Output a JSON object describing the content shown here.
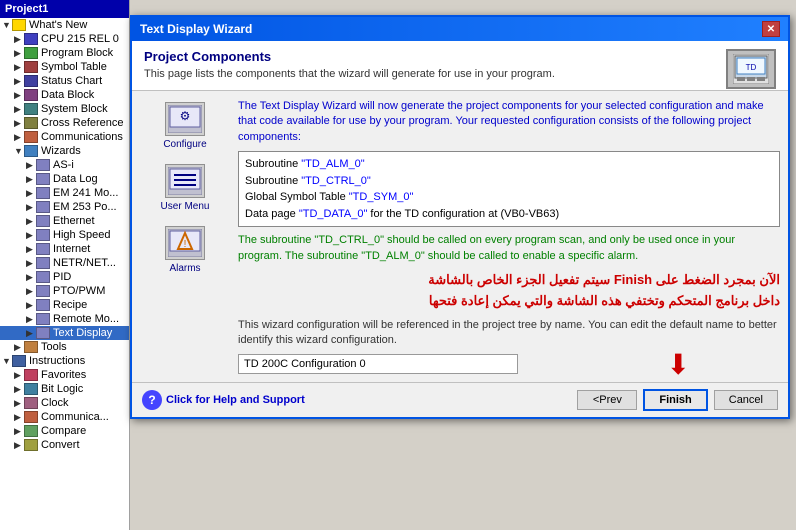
{
  "sidebar": {
    "title": "Project1",
    "items": [
      {
        "id": "whats-new",
        "label": "What's New",
        "icon": "folder",
        "indent": 0,
        "expand": true
      },
      {
        "id": "cpu",
        "label": "CPU 215 REL 0",
        "icon": "cpu",
        "indent": 1,
        "expand": false
      },
      {
        "id": "program-block",
        "label": "Program Block",
        "icon": "program",
        "indent": 1,
        "expand": false
      },
      {
        "id": "symbol-table",
        "label": "Symbol Table",
        "icon": "symbol",
        "indent": 1,
        "expand": false
      },
      {
        "id": "status-chart",
        "label": "Status Chart",
        "icon": "status",
        "indent": 1,
        "expand": false
      },
      {
        "id": "data-block",
        "label": "Data Block",
        "icon": "data",
        "indent": 1,
        "expand": false
      },
      {
        "id": "system-block",
        "label": "System Block",
        "icon": "system",
        "indent": 1,
        "expand": false
      },
      {
        "id": "cross-reference",
        "label": "Cross Reference",
        "icon": "cross",
        "indent": 1,
        "expand": false
      },
      {
        "id": "communications",
        "label": "Communications",
        "icon": "comm",
        "indent": 1,
        "expand": false
      },
      {
        "id": "wizards",
        "label": "Wizards",
        "icon": "wizard",
        "indent": 1,
        "expand": true
      },
      {
        "id": "as-i",
        "label": "AS-i",
        "icon": "generic",
        "indent": 2,
        "expand": false
      },
      {
        "id": "data-log",
        "label": "Data Log",
        "icon": "generic",
        "indent": 2,
        "expand": false
      },
      {
        "id": "em241",
        "label": "EM 241 Mo...",
        "icon": "generic",
        "indent": 2,
        "expand": false
      },
      {
        "id": "em253",
        "label": "EM 253 Po...",
        "icon": "generic",
        "indent": 2,
        "expand": false
      },
      {
        "id": "ethernet",
        "label": "Ethernet",
        "icon": "generic",
        "indent": 2,
        "expand": false
      },
      {
        "id": "high-speed",
        "label": "High Speed",
        "icon": "generic",
        "indent": 2,
        "expand": false
      },
      {
        "id": "internet",
        "label": "Internet",
        "icon": "generic",
        "indent": 2,
        "expand": false
      },
      {
        "id": "netr",
        "label": "NETR/NET...",
        "icon": "generic",
        "indent": 2,
        "expand": false
      },
      {
        "id": "pid",
        "label": "PID",
        "icon": "generic",
        "indent": 2,
        "expand": false
      },
      {
        "id": "pto-pwm",
        "label": "PTO/PWM",
        "icon": "generic",
        "indent": 2,
        "expand": false
      },
      {
        "id": "recipe",
        "label": "Recipe",
        "icon": "generic",
        "indent": 2,
        "expand": false
      },
      {
        "id": "remote-mod",
        "label": "Remote Mo...",
        "icon": "generic",
        "indent": 2,
        "expand": false
      },
      {
        "id": "text-display",
        "label": "Text Display",
        "icon": "generic",
        "indent": 2,
        "expand": false,
        "selected": true
      },
      {
        "id": "tools",
        "label": "Tools",
        "icon": "tools",
        "indent": 1,
        "expand": false
      },
      {
        "id": "instructions",
        "label": "Instructions",
        "icon": "instructions",
        "indent": 0,
        "expand": true
      },
      {
        "id": "favorites",
        "label": "Favorites",
        "icon": "favorites",
        "indent": 1,
        "expand": false
      },
      {
        "id": "bit-logic",
        "label": "Bit Logic",
        "icon": "bit",
        "indent": 1,
        "expand": false
      },
      {
        "id": "clock",
        "label": "Clock",
        "icon": "clock",
        "indent": 1,
        "expand": false
      },
      {
        "id": "communications2",
        "label": "Communica...",
        "icon": "comm",
        "indent": 1,
        "expand": false
      },
      {
        "id": "compare",
        "label": "Compare",
        "icon": "compare",
        "indent": 1,
        "expand": false
      },
      {
        "id": "convert",
        "label": "Convert",
        "icon": "convert",
        "indent": 1,
        "expand": false
      }
    ]
  },
  "dialog": {
    "title": "Text Display Wizard",
    "header": {
      "title": "Project Components",
      "description": "This page lists the components that the wizard will generate for use in your program."
    },
    "wizard_buttons": [
      {
        "id": "configure",
        "label": "Configure",
        "icon": "⚙"
      },
      {
        "id": "user-menu",
        "label": "User Menu",
        "icon": "☰"
      },
      {
        "id": "alarms",
        "label": "Alarms",
        "icon": "⚡"
      }
    ],
    "info_text_1": "The Text Display Wizard will now generate the project components for your selected configuration and make that code available for use by your program. Your requested configuration consists of the following project components:",
    "code_lines": [
      "Subroutine \"TD_ALM_0\"",
      "Subroutine \"TD_CTRL_0\"",
      "Global Symbol Table \"TD_SYM_0\"",
      "Data page \"TD_DATA_0\" for the TD configuration at (VB0-VB63)"
    ],
    "info_text_2": "The subroutine \"TD_CTRL_0\" should be called on every program scan, and only be used once in your program. The subroutine \"TD_ALM_0\" should be called to enable a specific alarm.",
    "arabic_line1": "الآن بمجرد الضغط على Finish سيتم تفعيل الجزء الخاص بالشاشة",
    "arabic_line2": "داخل برنامج المتحكم وتختفي هذه الشاشة والتي يمكن إعادة فتحها",
    "info_text_3": "This wizard configuration will be referenced in the project tree by name. You can edit the default name to better identify this wizard configuration.",
    "name_value": "TD 200C Configuration 0",
    "footer": {
      "help_label": "Click for Help and Support",
      "prev_label": "<Prev",
      "finish_label": "Finish",
      "cancel_label": "Cancel"
    }
  }
}
